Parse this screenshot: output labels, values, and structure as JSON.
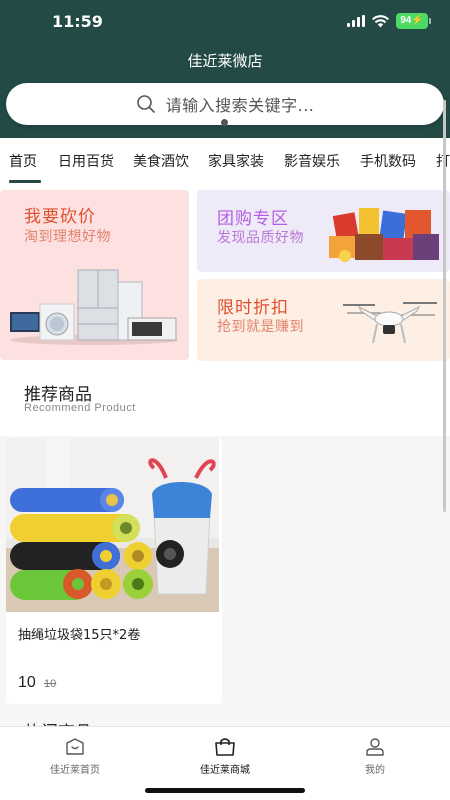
{
  "status_bar": {
    "time": "11:59",
    "battery": "94"
  },
  "header": {
    "title": "佳近莱微店"
  },
  "search": {
    "placeholder": "请输入搜索关键字..."
  },
  "category_tabs": [
    {
      "label": "首页",
      "active": true
    },
    {
      "label": "日用百货"
    },
    {
      "label": "美食酒饮"
    },
    {
      "label": "家具家装"
    },
    {
      "label": "影音娱乐"
    },
    {
      "label": "手机数码"
    },
    {
      "label": "打"
    }
  ],
  "promos": {
    "bargain": {
      "title": "我要砍价",
      "subtitle": "淘到理想好物",
      "title_color": "#e0502f",
      "sub_color": "#e3826d"
    },
    "group": {
      "title": "团购专区",
      "subtitle": "发现品质好物",
      "title_color": "#b55ee0",
      "sub_color": "#b879d6"
    },
    "discount": {
      "title": "限时折扣",
      "subtitle": "抢到就是赚到",
      "title_color": "#e0502f",
      "sub_color": "#e3826d"
    }
  },
  "recommend": {
    "title": "推荐商品",
    "subtitle": "Recommend Product"
  },
  "products": [
    {
      "name": "抽绳垃圾袋15只*2卷",
      "price": "10",
      "original_price": "10"
    }
  ],
  "hot": {
    "title": "热门商品"
  },
  "tabbar": {
    "items": [
      {
        "label": "佳近莱首页",
        "icon": "home-icon"
      },
      {
        "label": "佳近莱商城",
        "icon": "shopping-bag-icon",
        "active": true
      },
      {
        "label": "我的",
        "icon": "user-icon"
      }
    ]
  },
  "colors": {
    "primary": "#234a44",
    "accent_red": "#e0502f",
    "accent_purple": "#b55ee0"
  }
}
